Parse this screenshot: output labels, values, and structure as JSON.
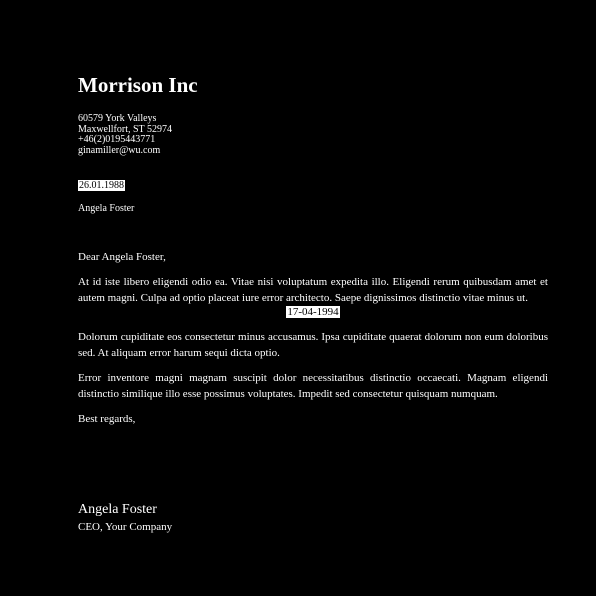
{
  "letterhead": {
    "company": "Morrison Inc",
    "address_lines": [
      "60579 York Valleys",
      "Maxwellfort, ST 52974",
      "+46(2)0195443771",
      "ginamiller@wu.com"
    ]
  },
  "date": "26.01.1988",
  "recipient": "Angela Foster",
  "greeting": "Dear Angela Foster,",
  "body": {
    "paragraph_1": "At id iste libero eligendi odio ea. Vitae nisi voluptatum expedita illo. Eligendi rerum quibusdam amet et autem magni. Culpa ad optio placeat iure error architecto. Saepe dignissimos distinctio vitae minus ut.",
    "paragraph_1_date": "17-04-1994",
    "paragraph_2": "Dolorum cupiditate eos consectetur minus accusamus. Ipsa cupiditate quaerat dolorum non eum doloribus sed. At aliquam error harum sequi dicta optio.",
    "paragraph_3": "Error inventore magni magnam suscipit dolor necessitatibus distinctio occaecati. Magnam eligendi distinctio similique illo esse possimus voluptates. Impedit sed consectetur quisquam numquam."
  },
  "closing": "Best regards,",
  "signature": {
    "name": "Angela Foster",
    "title": "CEO, Your Company"
  },
  "colors": {
    "background": "#000000",
    "text": "#ffffff",
    "highlight_background": "#ffffff",
    "highlight_text": "#000000"
  }
}
